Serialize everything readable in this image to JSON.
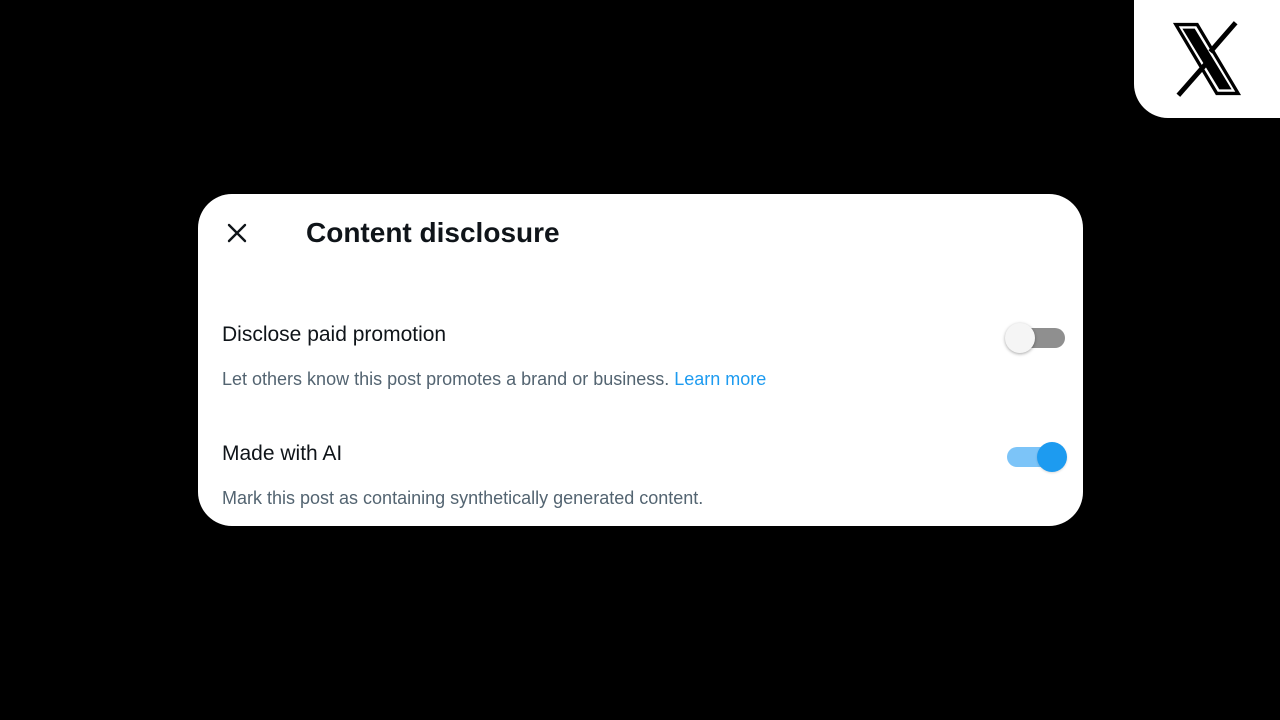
{
  "brand": {
    "logo_icon": "x-logo-icon",
    "badge_color": "#ffffff"
  },
  "dialog": {
    "title": "Content disclosure",
    "close_icon": "close-icon",
    "settings": [
      {
        "id": "paid-promotion",
        "label": "Disclose paid promotion",
        "description": "Let others know this post promotes a brand or business.",
        "link_text": "Learn more",
        "toggle_state": "off"
      },
      {
        "id": "made-with-ai",
        "label": "Made with AI",
        "description": "Mark this post as containing synthetically generated content.",
        "toggle_state": "on"
      }
    ]
  },
  "colors": {
    "background": "#000000",
    "dialog_background": "#ffffff",
    "text_primary": "#0f1419",
    "text_secondary": "#536471",
    "accent": "#1d9bf0",
    "toggle_on_track": "#7cc4f8",
    "toggle_off_track": "#8f8f8f"
  }
}
